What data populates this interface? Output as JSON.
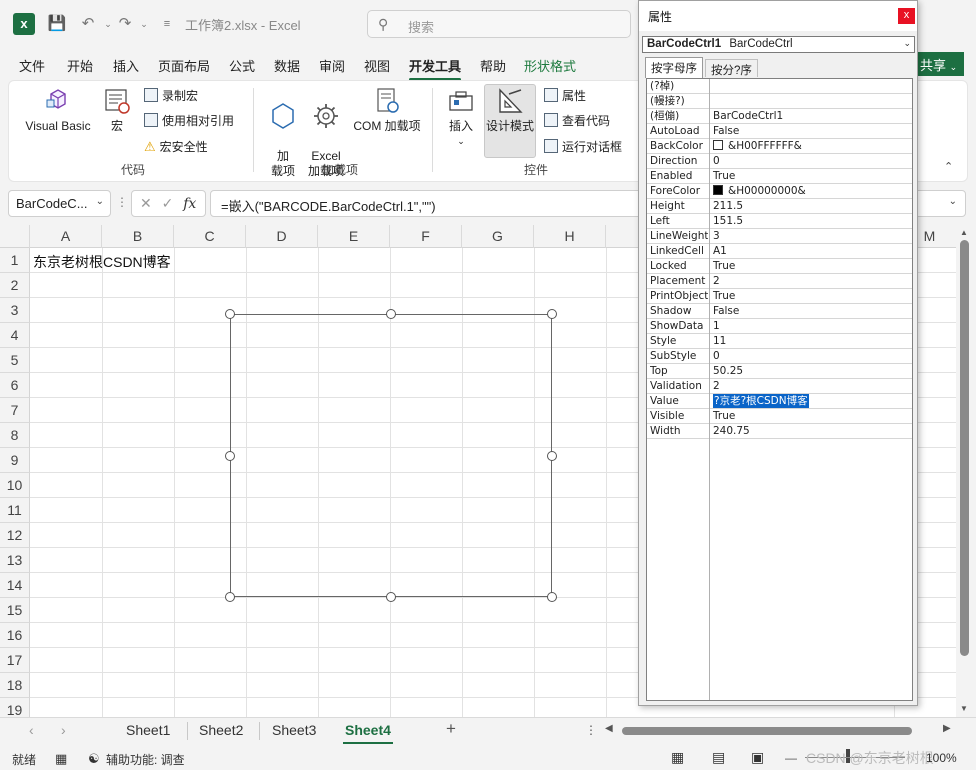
{
  "titlebar": {
    "doc_title": "工作簿2.xlsx  -  Excel",
    "search_placeholder": "搜索"
  },
  "menu": [
    "文件",
    "开始",
    "插入",
    "页面布局",
    "公式",
    "数据",
    "审阅",
    "视图",
    "开发工具",
    "帮助",
    "形状格式"
  ],
  "active_menu": "开发工具",
  "share_label": "共享",
  "ribbon": {
    "visual_basic": "Visual Basic",
    "macros": "宏",
    "record_macro": "录制宏",
    "relative_ref": "使用相对引用",
    "macro_security": "宏安全性",
    "group_code": "代码",
    "addins": "加\n载项",
    "excel_addins": "Excel\n加载项",
    "com_addins": "COM 加载项",
    "group_addins": "加载项",
    "insert": "插入",
    "design_mode": "设计模式",
    "properties": "属性",
    "view_code": "查看代码",
    "run_dialog": "运行对话框",
    "group_controls": "控件"
  },
  "formula_bar": {
    "name_box": "BarCodeC...",
    "formula": "=嵌入(\"BARCODE.BarCodeCtrl.1\",\"\")"
  },
  "columns": [
    "A",
    "B",
    "C",
    "D",
    "E",
    "F",
    "G",
    "H",
    "M"
  ],
  "rows": [
    "1",
    "2",
    "3",
    "4",
    "5",
    "6",
    "7",
    "8",
    "9",
    "10",
    "11",
    "12",
    "13",
    "14",
    "15",
    "16",
    "17",
    "18",
    "19"
  ],
  "cell_a1": "东京老树根CSDN博客",
  "sheets": [
    "Sheet1",
    "Sheet2",
    "Sheet3",
    "Sheet4"
  ],
  "active_sheet": "Sheet4",
  "status": {
    "ready": "就绪",
    "accessibility": "辅助功能: 调查",
    "zoom": "100%",
    "watermark": "CSDN @东京老树根"
  },
  "properties_window": {
    "title": "属性",
    "close": "x",
    "object_name": "BarCodeCtrl1",
    "object_type": "BarCodeCtrl",
    "tab_alpha": "按字母序",
    "tab_category": "按分?序",
    "rows": [
      {
        "name": "(?棹)",
        "value": ""
      },
      {
        "name": "(幔接?)",
        "value": ""
      },
      {
        "name": "(桓傰)",
        "value": "BarCodeCtrl1"
      },
      {
        "name": "AutoLoad",
        "value": "False"
      },
      {
        "name": "BackColor",
        "value": "&H00FFFFFF&",
        "swatch": "#ffffff"
      },
      {
        "name": "Direction",
        "value": "0"
      },
      {
        "name": "Enabled",
        "value": "True"
      },
      {
        "name": "ForeColor",
        "value": "&H00000000&",
        "swatch": "#000000"
      },
      {
        "name": "Height",
        "value": "211.5"
      },
      {
        "name": "Left",
        "value": "151.5"
      },
      {
        "name": "LineWeight",
        "value": "3"
      },
      {
        "name": "LinkedCell",
        "value": "A1"
      },
      {
        "name": "Locked",
        "value": "True"
      },
      {
        "name": "Placement",
        "value": "2"
      },
      {
        "name": "PrintObject",
        "value": "True"
      },
      {
        "name": "Shadow",
        "value": "False"
      },
      {
        "name": "ShowData",
        "value": "1"
      },
      {
        "name": "Style",
        "value": "11"
      },
      {
        "name": "SubStyle",
        "value": "0"
      },
      {
        "name": "Top",
        "value": "50.25"
      },
      {
        "name": "Validation",
        "value": "2"
      },
      {
        "name": "Value",
        "value": "?京老?根CSDN博客",
        "selected": true
      },
      {
        "name": "Visible",
        "value": "True"
      },
      {
        "name": "Width",
        "value": "240.75"
      }
    ]
  },
  "colors": {
    "excel_green": "#1d6f42",
    "selection_blue": "#0a64c8",
    "close_red": "#e81123"
  }
}
